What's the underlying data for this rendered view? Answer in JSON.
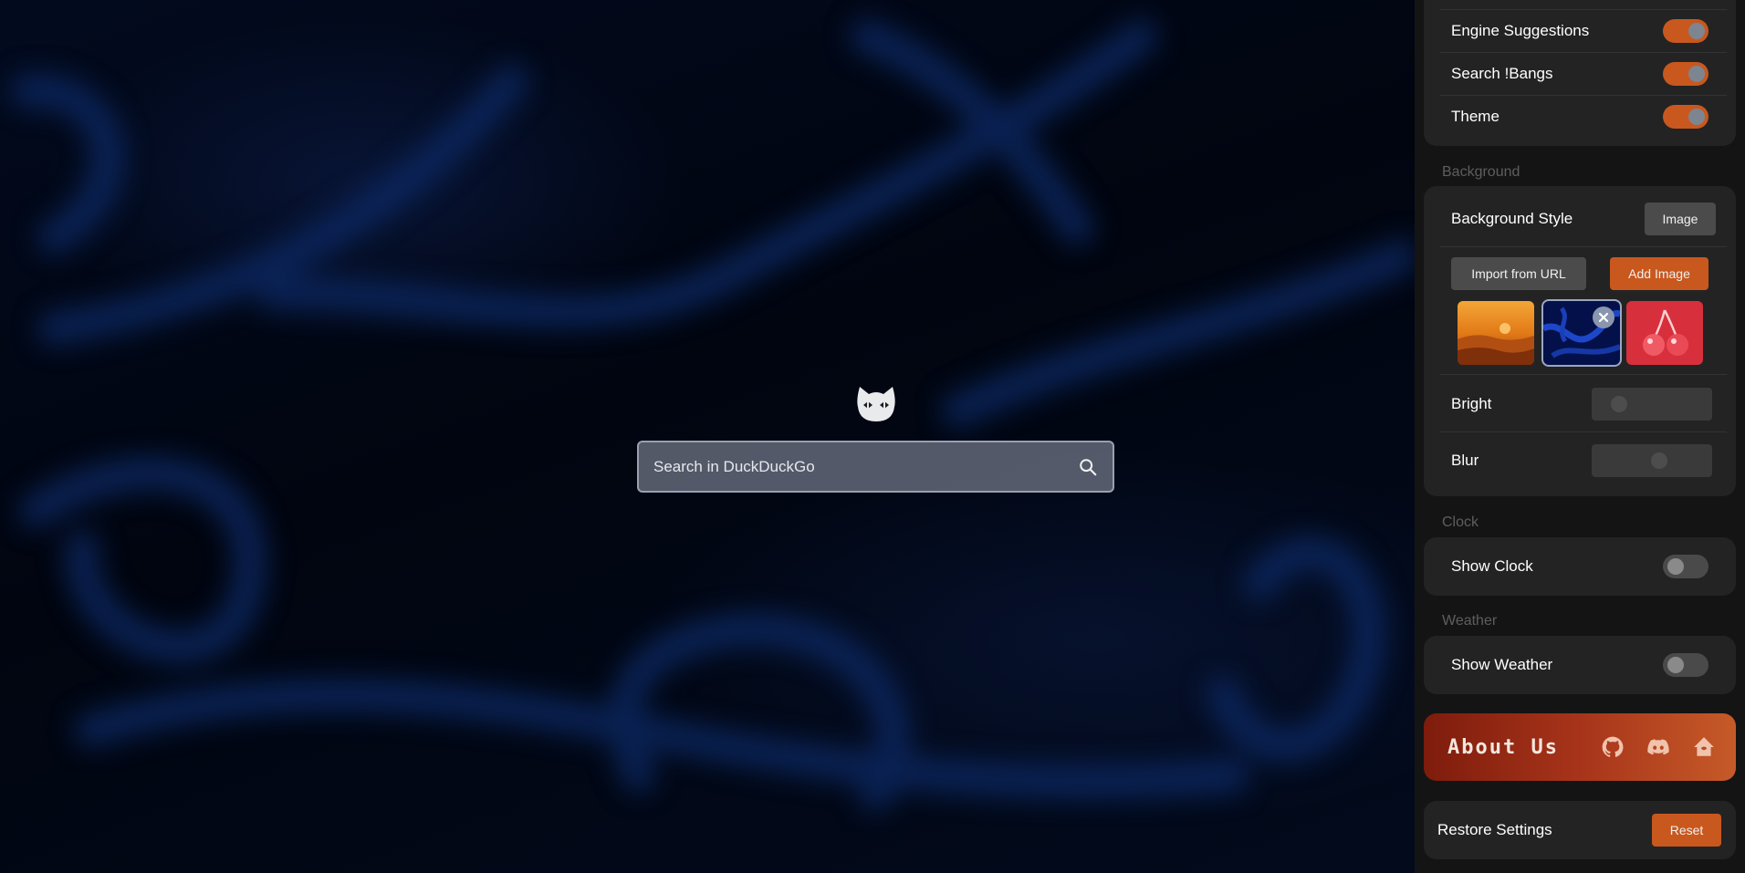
{
  "search": {
    "placeholder": "Search in DuckDuckGo"
  },
  "search_settings": {
    "rows": [
      {
        "label": "Engine Suggestions",
        "enabled": true
      },
      {
        "label": "Search !Bangs",
        "enabled": true
      },
      {
        "label": "Theme",
        "enabled": true
      }
    ]
  },
  "background": {
    "section_label": "Background",
    "style_label": "Background Style",
    "style_value": "Image",
    "import_label": "Import from URL",
    "add_label": "Add Image",
    "thumbnails": [
      "sunset-clouds",
      "blue-abstract",
      "red-cherries"
    ],
    "selected_thumbnail": 1,
    "remove_icon": "close-icon",
    "bright_label": "Bright",
    "bright_value": 0.15,
    "blur_label": "Blur",
    "blur_value": 0.58
  },
  "clock": {
    "section_label": "Clock",
    "show_label": "Show Clock",
    "enabled": false
  },
  "weather": {
    "section_label": "Weather",
    "show_label": "Show Weather",
    "enabled": false
  },
  "about": {
    "title": "About Us",
    "icons": [
      "github-icon",
      "discord-icon",
      "home-icon"
    ]
  },
  "restore": {
    "label": "Restore Settings",
    "button_label": "Reset"
  },
  "colors": {
    "accent": "#c8581e",
    "panel": "#141414",
    "card": "#232323"
  }
}
